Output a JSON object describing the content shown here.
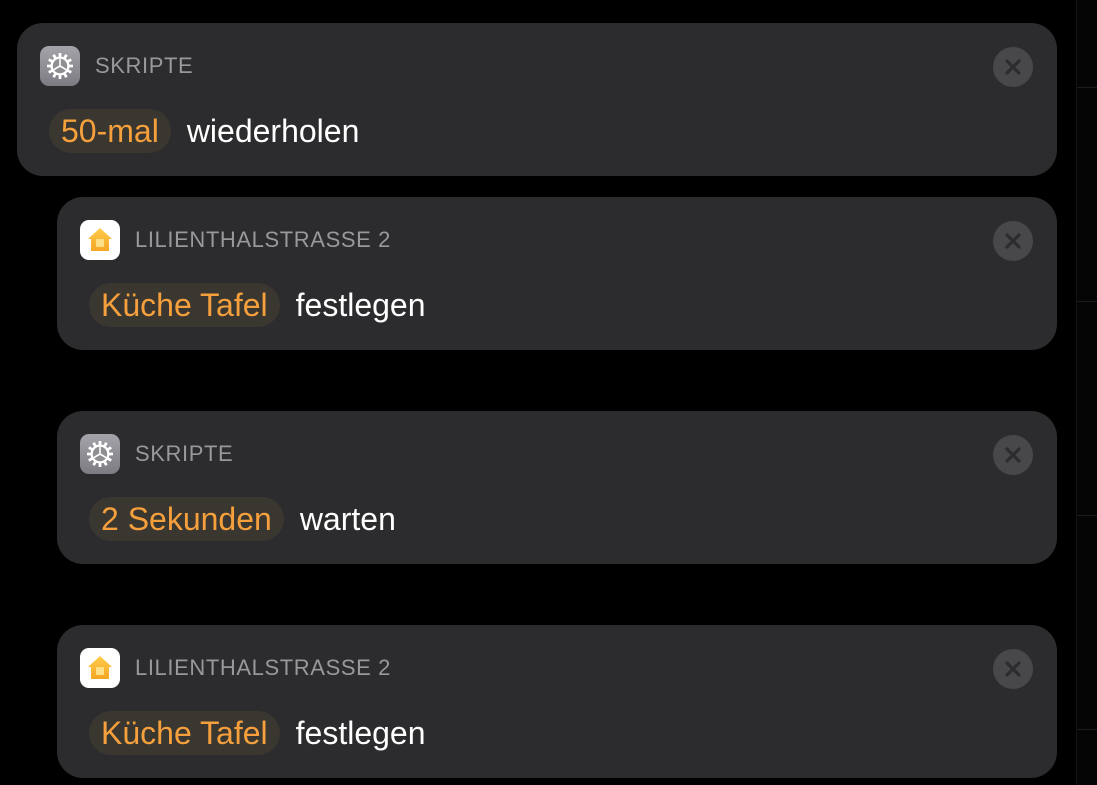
{
  "actions": [
    {
      "app_icon": "scripts-gear-icon",
      "category": "SKRIPTE",
      "parameter": "50-mal",
      "action": "wiederholen"
    },
    {
      "app_icon": "home-icon",
      "category": "LILIENTHALSTRASSE 2",
      "parameter": "Küche Tafel",
      "action": "festlegen"
    },
    {
      "app_icon": "scripts-gear-icon",
      "category": "SKRIPTE",
      "parameter": "2 Sekunden",
      "action": "warten"
    },
    {
      "app_icon": "home-icon",
      "category": "LILIENTHALSTRASSE 2",
      "parameter": "Küche Tafel",
      "action": "festlegen"
    }
  ],
  "colors": {
    "background": "#000000",
    "card": "#2c2c2e",
    "parameter_text": "#f5a03d",
    "parameter_bg": "#3a3630",
    "category_text": "#98989d",
    "action_text": "#ffffff",
    "close_button": "#48484a"
  }
}
